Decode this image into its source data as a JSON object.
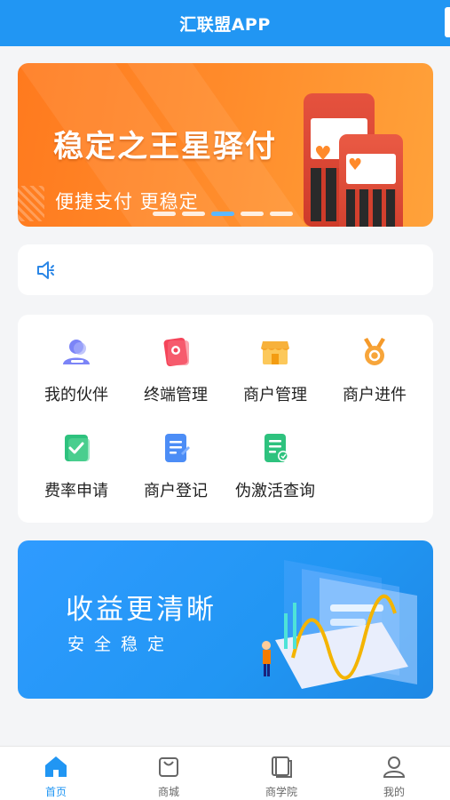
{
  "header": {
    "title": "汇联盟APP"
  },
  "banner": {
    "title": "稳定之王星驿付",
    "subtitle": "便捷支付 更稳定",
    "slide_count": 5,
    "active_slide": 3
  },
  "notice": {
    "icon": "speaker-icon",
    "text": ""
  },
  "menu": {
    "items": [
      {
        "label": "我的伙伴",
        "icon": "partner-icon",
        "color": "#6c7cf5"
      },
      {
        "label": "终端管理",
        "icon": "terminal-icon",
        "color": "#f5455a"
      },
      {
        "label": "商户管理",
        "icon": "shop-icon",
        "color": "#f7b13b"
      },
      {
        "label": "商户进件",
        "icon": "medal-icon",
        "color": "#f59a2a"
      },
      {
        "label": "费率申请",
        "icon": "rate-check-icon",
        "color": "#2ec27e"
      },
      {
        "label": "商户登记",
        "icon": "register-doc-icon",
        "color": "#4c8df6"
      },
      {
        "label": "伪激活查询",
        "icon": "query-doc-icon",
        "color": "#2ec27e"
      }
    ]
  },
  "promo": {
    "title": "收益更清晰",
    "subtitle": "安全稳定"
  },
  "tabbar": {
    "active": 0,
    "items": [
      {
        "label": "首页",
        "icon": "home-icon"
      },
      {
        "label": "商城",
        "icon": "shopping-bag-icon"
      },
      {
        "label": "商学院",
        "icon": "book-icon"
      },
      {
        "label": "我的",
        "icon": "user-icon"
      }
    ]
  },
  "colors": {
    "primary": "#2196f3",
    "banner_orange": "#ff8a2a",
    "background": "#f4f5f7"
  }
}
